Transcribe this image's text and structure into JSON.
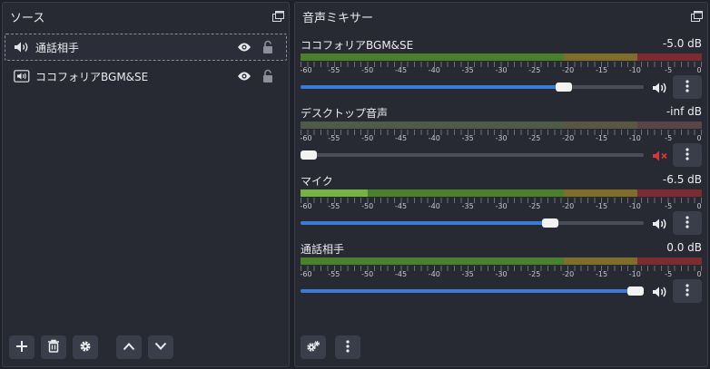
{
  "sources_dock": {
    "title": "ソース",
    "items": [
      {
        "label": "通話相手",
        "selected": true,
        "icon": "speaker-output-icon"
      },
      {
        "label": "ココフォリアBGM&SE",
        "selected": false,
        "icon": "audio-capture-icon"
      }
    ],
    "toolbar": [
      "add-icon",
      "trash-icon",
      "gear-icon",
      "chevron-up-icon",
      "chevron-down-icon"
    ]
  },
  "mixer_dock": {
    "title": "音声ミキサー",
    "scale_labels": [
      "-60",
      "-55",
      "-50",
      "-45",
      "-40",
      "-35",
      "-30",
      "-25",
      "-20",
      "-15",
      "-10",
      "-5",
      "0"
    ],
    "channels": [
      {
        "name": "ココフォリアBGM&SE",
        "db": "-5.0 dB",
        "volume_fraction": 0.78,
        "muted": false,
        "meter_active": true
      },
      {
        "name": "デスクトップ音声",
        "db": "-inf dB",
        "volume_fraction": 0.0,
        "muted": true,
        "meter_active": false
      },
      {
        "name": "マイク",
        "db": "-6.5 dB",
        "volume_fraction": 0.74,
        "muted": false,
        "meter_active": true,
        "meter_level_db": -50
      },
      {
        "name": "通話相手",
        "db": "0.0 dB",
        "volume_fraction": 1.0,
        "muted": false,
        "meter_active": true
      }
    ],
    "toolbar": [
      "gear-advanced-icon",
      "kebab-menu-icon"
    ]
  },
  "colors": {
    "meter_green": "#4d8a2a",
    "meter_yellow": "#8a7a2a",
    "meter_red": "#8a2a32",
    "slider_fill": "#3a7bd5",
    "mute_red": "#d23a3a"
  }
}
